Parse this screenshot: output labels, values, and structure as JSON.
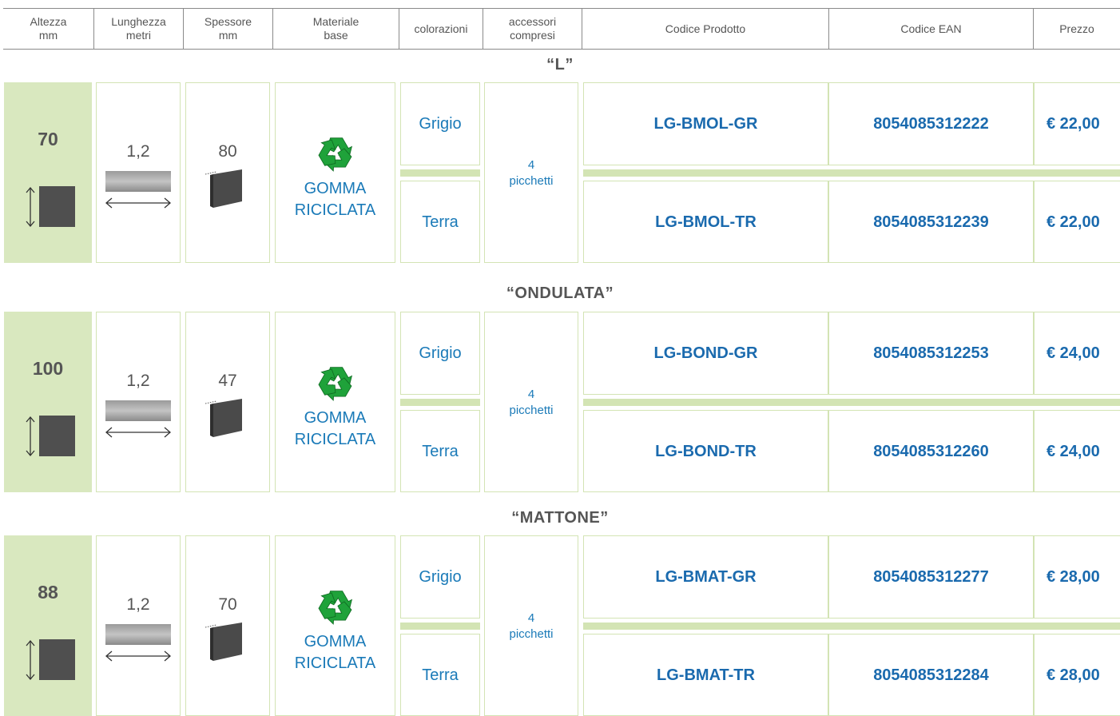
{
  "columns": [
    {
      "label": "Altezza\nmm"
    },
    {
      "label": "Lunghezza\nmetri"
    },
    {
      "label": "Spessore\nmm"
    },
    {
      "label": "Materiale\nbase"
    },
    {
      "label": "colorazioni"
    },
    {
      "label": "accessori\ncompresi"
    },
    {
      "label": "Codice Prodotto"
    },
    {
      "label": "Codice EAN"
    },
    {
      "label": "Prezzo"
    }
  ],
  "sections": [
    {
      "title": "“L”",
      "altezza": "70",
      "lunghezza": "1,2",
      "spessore": "80",
      "materiale_line1": "GOMMA",
      "materiale_line2": "RICICLATA",
      "accessori_line1": "4",
      "accessori_line2": "picchetti",
      "variants": [
        {
          "colore": "Grigio",
          "codice": "LG-BMOL-GR",
          "ean": "8054085312222",
          "prezzo": "€ 22,00"
        },
        {
          "colore": "Terra",
          "codice": "LG-BMOL-TR",
          "ean": "8054085312239",
          "prezzo": "€ 22,00"
        }
      ]
    },
    {
      "title": "“ONDULATA”",
      "altezza": "100",
      "lunghezza": "1,2",
      "spessore": "47",
      "materiale_line1": "GOMMA",
      "materiale_line2": "RICICLATA",
      "accessori_line1": "4",
      "accessori_line2": "picchetti",
      "variants": [
        {
          "colore": "Grigio",
          "codice": "LG-BOND-GR",
          "ean": "8054085312253",
          "prezzo": "€ 24,00"
        },
        {
          "colore": "Terra",
          "codice": "LG-BOND-TR",
          "ean": "8054085312260",
          "prezzo": "€ 24,00"
        }
      ]
    },
    {
      "title": "“MATTONE”",
      "altezza": "88",
      "lunghezza": "1,2",
      "spessore": "70",
      "materiale_line1": "GOMMA",
      "materiale_line2": "RICICLATA",
      "accessori_line1": "4",
      "accessori_line2": "picchetti",
      "variants": [
        {
          "colore": "Grigio",
          "codice": "LG-BMAT-GR",
          "ean": "8054085312277",
          "prezzo": "€ 28,00"
        },
        {
          "colore": "Terra",
          "codice": "LG-BMAT-TR",
          "ean": "8054085312284",
          "prezzo": "€ 28,00"
        }
      ]
    }
  ],
  "colors": {
    "header_green": "#d9e8bf",
    "border_green": "#d3e4b4",
    "code_blue": "#1a6aae",
    "recycle_green": "#1fa23a",
    "text_gray": "#555555"
  },
  "icons": {
    "height_icon": "vertical-arrow-square-icon",
    "length_icon": "horizontal-arrow-bar-icon",
    "thickness_icon": "slab-icon",
    "material_icon": "recycle-icon"
  }
}
